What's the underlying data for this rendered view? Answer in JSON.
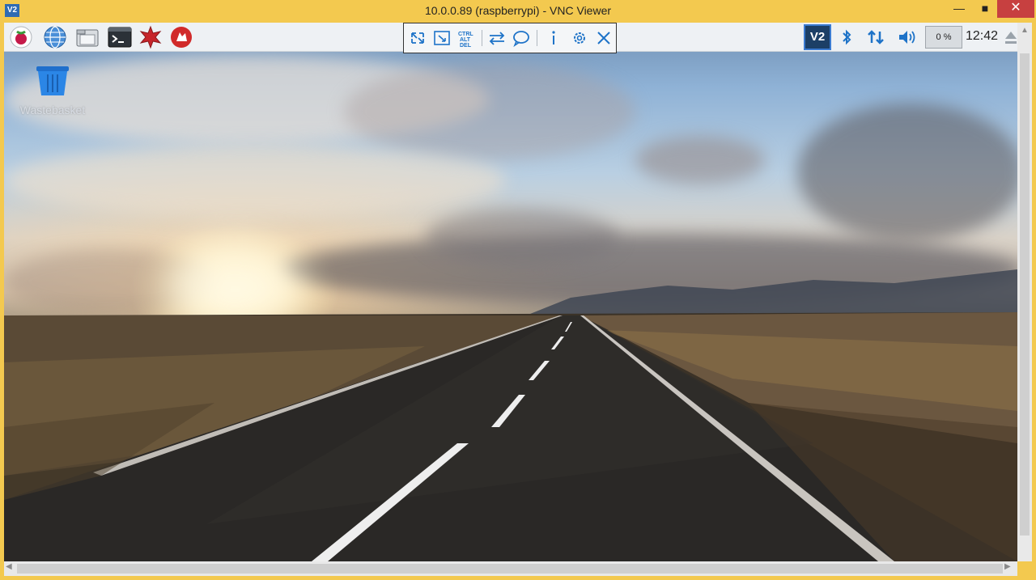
{
  "window": {
    "title": "10.0.0.89 (raspberrypi) - VNC Viewer",
    "app_icon": "V2",
    "minimize_glyph": "—",
    "maximize_glyph": "■",
    "close_glyph": "✕"
  },
  "pi_panel": {
    "launchers": [
      "raspberry-menu-icon",
      "web-browser-icon",
      "file-manager-icon",
      "terminal-icon",
      "mathematica-icon",
      "wolfram-icon"
    ],
    "tray": {
      "vnc_label": "V2",
      "cpu": "0 %",
      "clock": "12:42",
      "icons": [
        "bluetooth-icon",
        "network-icon",
        "volume-icon",
        "eject-icon"
      ]
    }
  },
  "vnc_toolbar": {
    "buttons": [
      "fullscreen",
      "scale",
      "ctrl-alt-del",
      "transfer-files",
      "chat",
      "info",
      "properties",
      "disconnect"
    ]
  },
  "desktop": {
    "icons": [
      {
        "label": "Wastebasket"
      }
    ]
  },
  "colors": {
    "window_frame": "#f3c94f",
    "accent": "#1e73c8",
    "close_button": "#c74040"
  }
}
